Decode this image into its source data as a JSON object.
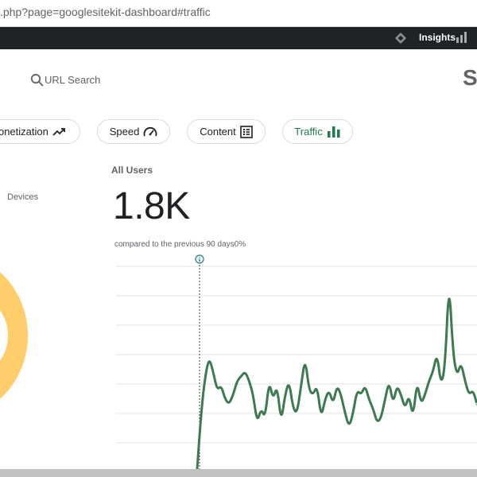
{
  "browser": {
    "url": ".php?page=googlesitekit-dashboard#traffic"
  },
  "admin_bar": {
    "insights_label": "Insights",
    "icons": [
      "sitekit-diamond-icon",
      "bar-chart-icon"
    ]
  },
  "header": {
    "search_label": "URL Search",
    "brand_partial": "S"
  },
  "nav": {
    "chips": [
      {
        "label": "Monetization",
        "icon": "trending-up-icon"
      },
      {
        "label": "Speed",
        "icon": "speedometer-icon"
      },
      {
        "label": "Content",
        "icon": "content-list-icon"
      },
      {
        "label": "Traffic",
        "icon": "bar-chart-icon",
        "active": true
      }
    ],
    "active_color": "#1f7a4c"
  },
  "devices": {
    "label": "Devices",
    "donut_color": "#ffce6b"
  },
  "metric": {
    "title": "All Users",
    "value": "1.8K",
    "comparison": "compared to the previous 90 days0%"
  },
  "chart_data": {
    "type": "line",
    "title": "",
    "xlabel": "",
    "ylabel": "",
    "line_color": "#3d7a4f",
    "grid": true,
    "ylim": [
      0,
      220
    ],
    "values": [
      0,
      60,
      100,
      120,
      105,
      85,
      90,
      75,
      70,
      80,
      95,
      100,
      105,
      95,
      80,
      50,
      65,
      55,
      95,
      75,
      90,
      50,
      80,
      95,
      65,
      60,
      90,
      120,
      85,
      80,
      90,
      55,
      75,
      85,
      70,
      90,
      80,
      60,
      45,
      60,
      85,
      80,
      90,
      75,
      65,
      50,
      55,
      75,
      95,
      70,
      90,
      80,
      65,
      80,
      55,
      95,
      70,
      80,
      95,
      105,
      125,
      90,
      110,
      205,
      125,
      100,
      115,
      95,
      80,
      85,
      70
    ]
  }
}
